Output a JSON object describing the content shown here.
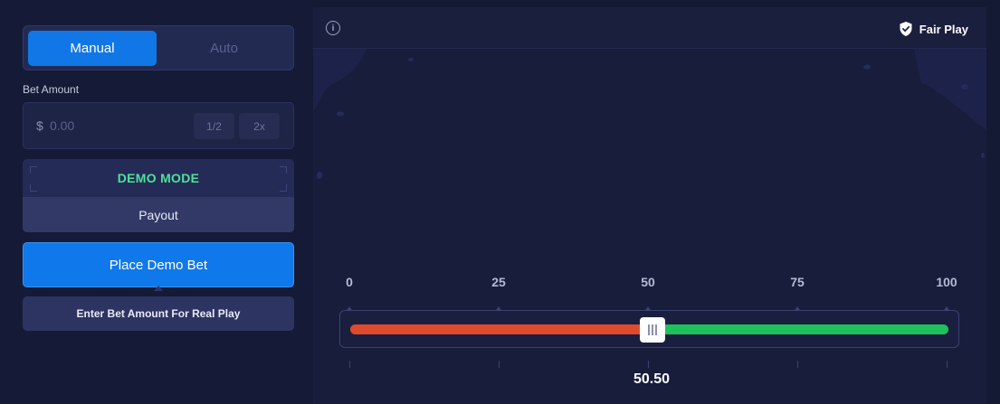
{
  "modes": {
    "manual_label": "Manual",
    "auto_label": "Auto",
    "active": "manual"
  },
  "bet": {
    "label": "Bet Amount",
    "currency_symbol": "$",
    "placeholder": "0.00",
    "value": "",
    "half_label": "1/2",
    "double_label": "2x"
  },
  "demo": {
    "mode_label": "DEMO MODE",
    "payout_label": "Payout"
  },
  "actions": {
    "place_bet_label": "Place Demo Bet",
    "real_play_hint": "Enter Bet Amount For Real Play"
  },
  "game": {
    "info_icon": "info-icon",
    "fair_play_icon": "shield-check-icon",
    "fair_play_label": "Fair Play"
  },
  "slider": {
    "ticks": [
      "0",
      "25",
      "50",
      "75",
      "100"
    ],
    "min": 0,
    "max": 100,
    "value": 50.5,
    "value_label": "50.50",
    "lose_color": "#e04a2c",
    "win_color": "#1ec25d"
  },
  "colors": {
    "accent": "#1277e6",
    "demo_green": "#4ee19a",
    "background": "#141a33"
  }
}
